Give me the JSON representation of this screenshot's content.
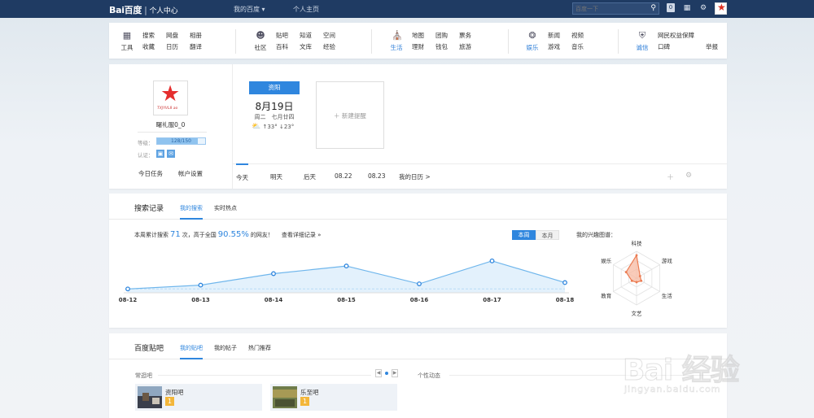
{
  "header": {
    "logo": "Bai百度",
    "logo_suffix": "个人中心",
    "my_baidu": "我的百度 ▾",
    "personal_home": "个人主页",
    "search_placeholder": "百度一下",
    "message_count": "0"
  },
  "nav": {
    "groups": [
      {
        "label": "工具",
        "icon": "grid-icon",
        "items": [
          "搜索",
          "收藏",
          "网盘",
          "日历",
          "相册",
          "翻译"
        ]
      },
      {
        "label": "社区",
        "icon": "user-icon",
        "items": [
          "贴吧",
          "百科",
          "知道",
          "文库",
          "空间",
          "经验"
        ]
      },
      {
        "label": "生活",
        "icon": "store-icon",
        "items": [
          "地图",
          "理财",
          "团购",
          "钱包",
          "票务",
          "旅游"
        ]
      },
      {
        "label": "娱乐",
        "icon": "film-icon",
        "items": [
          "新闻",
          "游戏",
          "视频",
          "音乐"
        ]
      },
      {
        "label": "诚信",
        "icon": "shield-icon",
        "items": [
          "网民权益保障",
          "口碑",
          "举报"
        ]
      }
    ]
  },
  "profile": {
    "avatar_text": "TXJYVL8 ao",
    "username": "曙礼服0_0",
    "level_label": "等级：",
    "level_progress_text": "128/150",
    "level_progress": 0.853,
    "auth_label": "认证：",
    "today_task": "今日任务",
    "account_settings": "帐户设置"
  },
  "calendar": {
    "location": "资阳",
    "date": "8月19日",
    "lunar": "周二　七月廿四",
    "weather": "↑33° ↓23°",
    "new_reminder": "＋ 新建提醒",
    "tabs": [
      "今天",
      "明天",
      "后天",
      "08.22",
      "08.23",
      "我的日历 >"
    ]
  },
  "search_record": {
    "title": "搜索记录",
    "tabs": [
      "我的搜索",
      "实时热点"
    ],
    "summary_prefix": "本周累计搜索",
    "summary_count": "71",
    "summary_mid": "次，高于全国",
    "summary_percent": "90.55%",
    "summary_suffix": "的网友！",
    "detail_link": "查看详细记录 »",
    "week_btn": "本周",
    "month_btn": "本月",
    "interest_title": "我的兴趣图谱："
  },
  "chart_data": [
    {
      "type": "area",
      "x": [
        "08-12",
        "08-13",
        "08-14",
        "08-15",
        "08-16",
        "08-17",
        "08-18"
      ],
      "values": [
        3,
        6,
        15,
        21,
        7,
        25,
        8
      ],
      "ylim": [
        0,
        30
      ],
      "grid": false,
      "colors": {
        "line": "#6fb6ec",
        "fill": "#e3f1fc",
        "point": "#2f86de"
      }
    },
    {
      "type": "radar",
      "categories": [
        "科技",
        "游戏",
        "生活",
        "文艺",
        "教育",
        "娱乐"
      ],
      "values": [
        0.85,
        0.15,
        0.2,
        0.15,
        0.2,
        0.45
      ],
      "colors": {
        "fill": "#f7b9a1",
        "line": "#ec7c52"
      }
    }
  ],
  "tieba": {
    "title": "百度贴吧",
    "tabs": [
      "我的贴吧",
      "我的帖子",
      "热门推荐"
    ],
    "frequent_label": "常逛吧",
    "activity_label": "个性动态",
    "bars": [
      {
        "name": "资阳吧",
        "level": "1"
      },
      {
        "name": "乐至吧",
        "level": "1"
      }
    ]
  },
  "watermark": {
    "text": "Bai 经验",
    "url": "jingyan.baidu.com"
  }
}
